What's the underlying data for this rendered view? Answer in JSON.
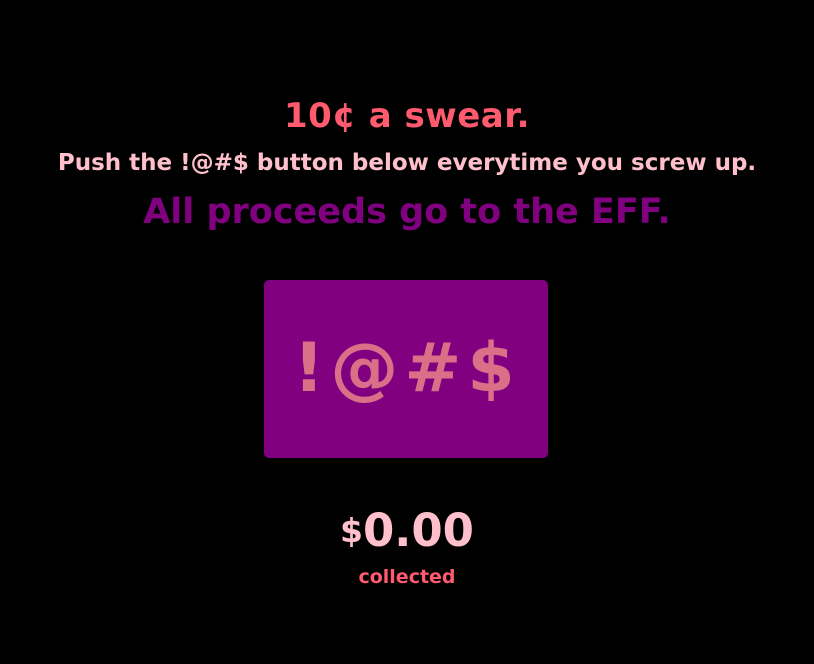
{
  "header": {
    "title": "10¢ a swear.",
    "instructions": "Push the !@#$ button below everytime you screw up.",
    "proceeds": "All proceeds go to the EFF."
  },
  "button": {
    "label": "!@#$"
  },
  "total": {
    "currency_symbol": "$",
    "amount": "0.00",
    "caption": "collected"
  },
  "colors": {
    "background": "#000000",
    "title": "#ff5a6e",
    "instructions": "#ffc0cb",
    "proceeds": "#800080",
    "button_bg": "#800080",
    "button_text": "#d97088",
    "total": "#ffc0cb",
    "caption": "#ff5a6e"
  }
}
